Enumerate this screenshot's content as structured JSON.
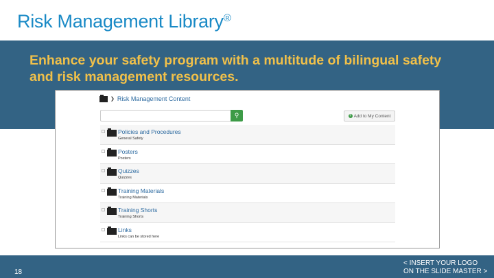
{
  "slide": {
    "title": "Risk Management Library",
    "title_mark": "®",
    "subtitle": "Enhance your safety program with a multitude of bilingual safety and risk management resources.",
    "page_number": "18",
    "logo_placeholder_line1": "< INSERT YOUR LOGO",
    "logo_placeholder_line2": "ON THE SLIDE MASTER >"
  },
  "app": {
    "breadcrumb": "Risk Management Content",
    "search_placeholder": "",
    "search_icon": "search-icon",
    "add_button": "Add to My Content",
    "items": [
      {
        "name": "Policies and Procedures",
        "desc": "General Safety"
      },
      {
        "name": "Posters",
        "desc": "Posters"
      },
      {
        "name": "Quizzes",
        "desc": "Quizzes"
      },
      {
        "name": "Training Materials",
        "desc": "Training Materials"
      },
      {
        "name": "Training Shorts",
        "desc": "Training Shorts"
      },
      {
        "name": "Links",
        "desc": "Links can be stored here"
      }
    ]
  },
  "colors": {
    "band": "#336384",
    "title": "#1a8ac6",
    "subtitle": "#f0c04a",
    "accent_green": "#3d9b47"
  }
}
